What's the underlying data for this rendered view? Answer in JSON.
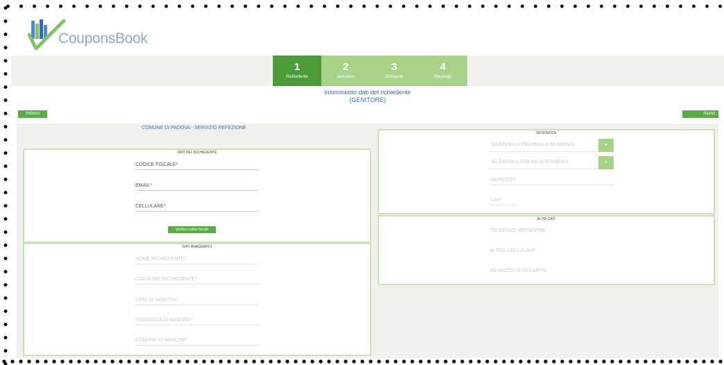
{
  "brand": {
    "name": "CouponsBook",
    "logo_colors": [
      "#4f8ad0",
      "#7fc36b",
      "#2f6fb8"
    ]
  },
  "steps": [
    {
      "num": "1",
      "label": "Richiedente",
      "active": true
    },
    {
      "num": "2",
      "label": "Iscrizione",
      "active": false
    },
    {
      "num": "3",
      "label": "Domande",
      "active": false
    },
    {
      "num": "4",
      "label": "Riepilogo",
      "active": false
    }
  ],
  "title": {
    "line1": "Inserimento dati del richiedente",
    "line2": "(GENITORE)"
  },
  "buttons": {
    "back": "Indietro",
    "next": "Avanti",
    "verify": "Verifica codice fiscale"
  },
  "left_caption": "COMUNE DI PADOVA - SERVIZIO REFEZIONE",
  "sections": {
    "fiscal": {
      "title": "DATI DEL RICHIEDENTE",
      "fields": [
        "CODICE FISCALE*",
        "EMAIL*",
        "CELLULARE*"
      ]
    },
    "personal": {
      "title": "DATI ANAGRAFICI",
      "fields": [
        "NOME RICHIEDENTE*",
        "COGNOME RICHIEDENTE*",
        "DATA DI NASCITA*",
        "PROVINCIA DI NASCITA*",
        "COMUNE DI NASCITA*"
      ]
    },
    "residence": {
      "title": "RESIDENZA",
      "selects": [
        "SELEZIONA LA PROVINCIA DI RESIDENZA",
        "SELEZIONA IL COMUNE DI RESIDENZA"
      ],
      "fields": [
        "INDIRIZZO*",
        "CAP*"
      ]
    },
    "other": {
      "title": "ALTRI DATI",
      "fields": [
        "TELEFONO ABITAZIONE",
        "ALTRO CELLULARE",
        "INDIRIZZO DI RECAPITO"
      ]
    }
  },
  "colors": {
    "step_active": "#4b9b3a",
    "step_inactive": "#a9d289",
    "accent_blue": "#3b6fb5",
    "button_green": "#5aac44",
    "panel_border": "#c9e3b8"
  }
}
